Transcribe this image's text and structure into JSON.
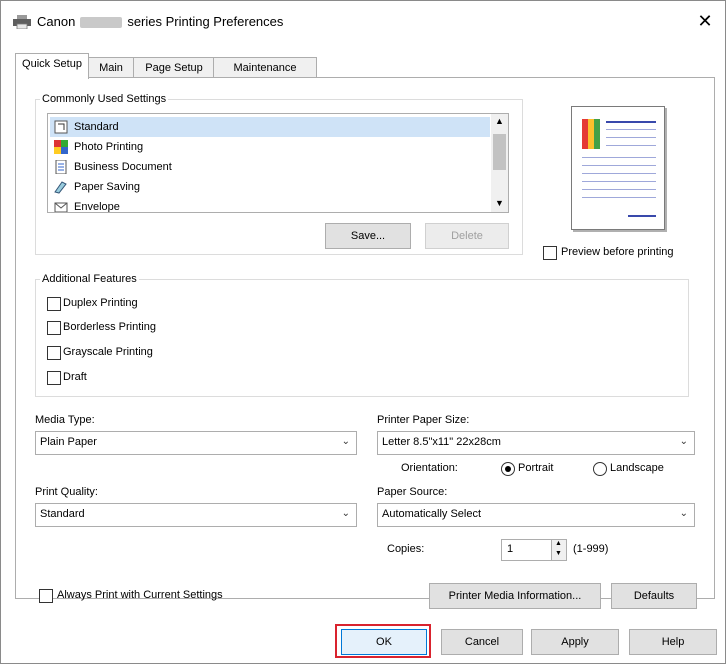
{
  "window": {
    "title_prefix": "Canon",
    "title_suffix": "series Printing Preferences",
    "close_glyph": "✕"
  },
  "tabs": [
    {
      "label": "Quick Setup",
      "active": true
    },
    {
      "label": "Main",
      "active": false
    },
    {
      "label": "Page Setup",
      "active": false
    },
    {
      "label": "Maintenance",
      "active": false
    }
  ],
  "commonly_used": {
    "legend": "Commonly Used Settings",
    "items": [
      {
        "label": "Standard",
        "icon": "standard-icon",
        "selected": true
      },
      {
        "label": "Photo Printing",
        "icon": "photo-icon",
        "selected": false
      },
      {
        "label": "Business Document",
        "icon": "document-icon",
        "selected": false
      },
      {
        "label": "Paper Saving",
        "icon": "paper-saving-icon",
        "selected": false
      },
      {
        "label": "Envelope",
        "icon": "envelope-icon",
        "selected": false
      }
    ],
    "save_label": "Save...",
    "delete_label": "Delete"
  },
  "preview": {
    "checkbox_label": "Preview before printing",
    "checked": false
  },
  "additional_features": {
    "legend": "Additional Features",
    "items": [
      {
        "label": "Duplex Printing",
        "checked": false
      },
      {
        "label": "Borderless Printing",
        "checked": false
      },
      {
        "label": "Grayscale Printing",
        "checked": false
      },
      {
        "label": "Draft",
        "checked": false
      }
    ]
  },
  "media_type": {
    "label": "Media Type:",
    "value": "Plain Paper"
  },
  "printer_paper_size": {
    "label": "Printer Paper Size:",
    "value": "Letter 8.5\"x11\" 22x28cm"
  },
  "orientation": {
    "label": "Orientation:",
    "portrait": "Portrait",
    "landscape": "Landscape",
    "selected": "Portrait"
  },
  "print_quality": {
    "label": "Print Quality:",
    "value": "Standard"
  },
  "paper_source": {
    "label": "Paper Source:",
    "value": "Automatically Select"
  },
  "copies": {
    "label": "Copies:",
    "value": "1",
    "range": "(1-999)"
  },
  "always_print": {
    "label": "Always Print with Current Settings",
    "checked": false
  },
  "printer_media_info_label": "Printer Media Information...",
  "defaults_label": "Defaults",
  "footer": {
    "ok": "OK",
    "cancel": "Cancel",
    "apply": "Apply",
    "help": "Help"
  },
  "colors": {
    "highlight": "#d9232e",
    "selection": "#cfe3f7"
  }
}
